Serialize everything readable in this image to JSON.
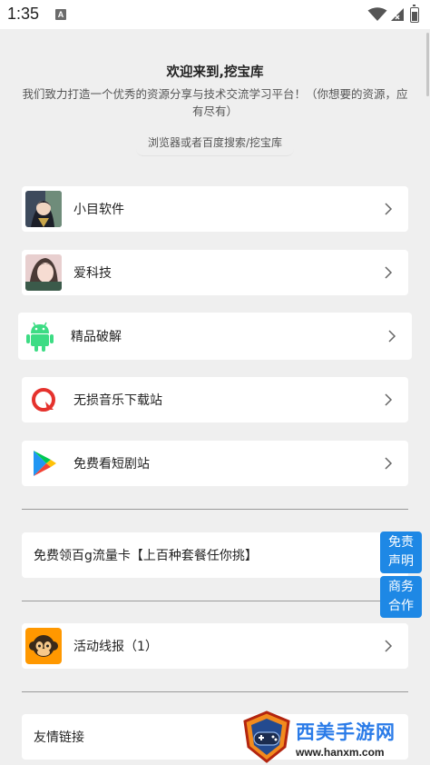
{
  "status_bar": {
    "time": "1:35",
    "notif_letter": "A"
  },
  "header": {
    "title": "欢迎来到,挖宝库",
    "description": "我们致力打造一个优秀的资源分享与技术交流学习平台！（你想要的资源，应有尽有）",
    "hint": "浏览器或者百度搜索/挖宝库"
  },
  "cards": [
    {
      "label": "小目软件",
      "icon": "anime-avatar-image"
    },
    {
      "label": "爱科技",
      "icon": "girl-avatar-image"
    },
    {
      "label": "精品破解",
      "icon": "android-robot-icon"
    },
    {
      "label": "无损音乐下载站",
      "icon": "red-circle-logo-icon"
    },
    {
      "label": "免费看短剧站",
      "icon": "play-store-icon"
    }
  ],
  "promo": {
    "label": "免费领百g流量卡【上百种套餐任你挑】"
  },
  "activity": {
    "label": "活动线报（1）",
    "icon": "monkey-icon"
  },
  "friend_links": {
    "label": "友情链接"
  },
  "float_buttons": [
    {
      "line1": "免责",
      "line2": "声明"
    },
    {
      "line1": "商务",
      "line2": "合作"
    }
  ],
  "watermark": {
    "name": "西美手游网",
    "url": "www.hanxm.com"
  }
}
